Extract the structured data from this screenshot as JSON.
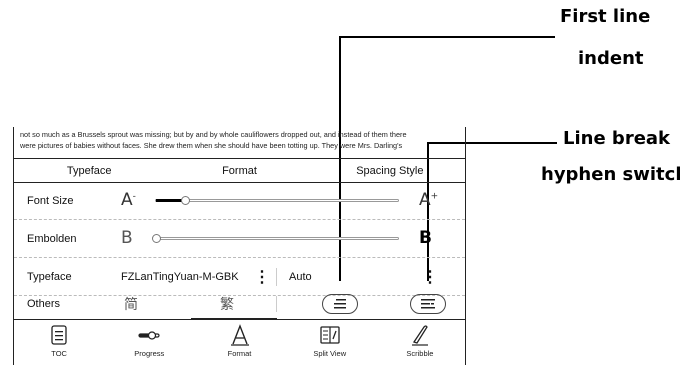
{
  "callouts": {
    "first_line_indent": [
      "First line",
      "indent"
    ],
    "line_break_hyphen": [
      "Line break",
      "hyphen switch"
    ]
  },
  "reader": {
    "line1": "not so much as a Brussels sprout was missing; but by and by whole cauliflowers dropped out, and instead of them there",
    "line2": "were pictures of babies without faces. She drew them when she should have been totting up. They were Mrs. Darling's"
  },
  "tabs": [
    {
      "label": "Typeface"
    },
    {
      "label": "Format"
    },
    {
      "label": "Spacing Style"
    }
  ],
  "rows": {
    "font_size": {
      "label": "Font Size",
      "min_glyph": "A",
      "min_sup": "-",
      "max_glyph": "A",
      "max_sup": "+",
      "level": 0.12
    },
    "embolden": {
      "label": "Embolden",
      "min_glyph": "B",
      "max_glyph": "B",
      "level": 0.0
    },
    "typeface": {
      "label": "Typeface",
      "font_name": "FZLanTingYuan-M-GBK",
      "second_value": "Auto"
    },
    "others": {
      "label": "Others",
      "simplified": "简",
      "traditional": "繁"
    }
  },
  "bottom_nav": [
    {
      "label": "TOC",
      "icon": "toc-icon"
    },
    {
      "label": "Progress",
      "icon": "progress-icon"
    },
    {
      "label": "Format",
      "icon": "format-icon"
    },
    {
      "label": "Split View",
      "icon": "split-view-icon"
    },
    {
      "label": "Scribble",
      "icon": "scribble-icon"
    }
  ]
}
